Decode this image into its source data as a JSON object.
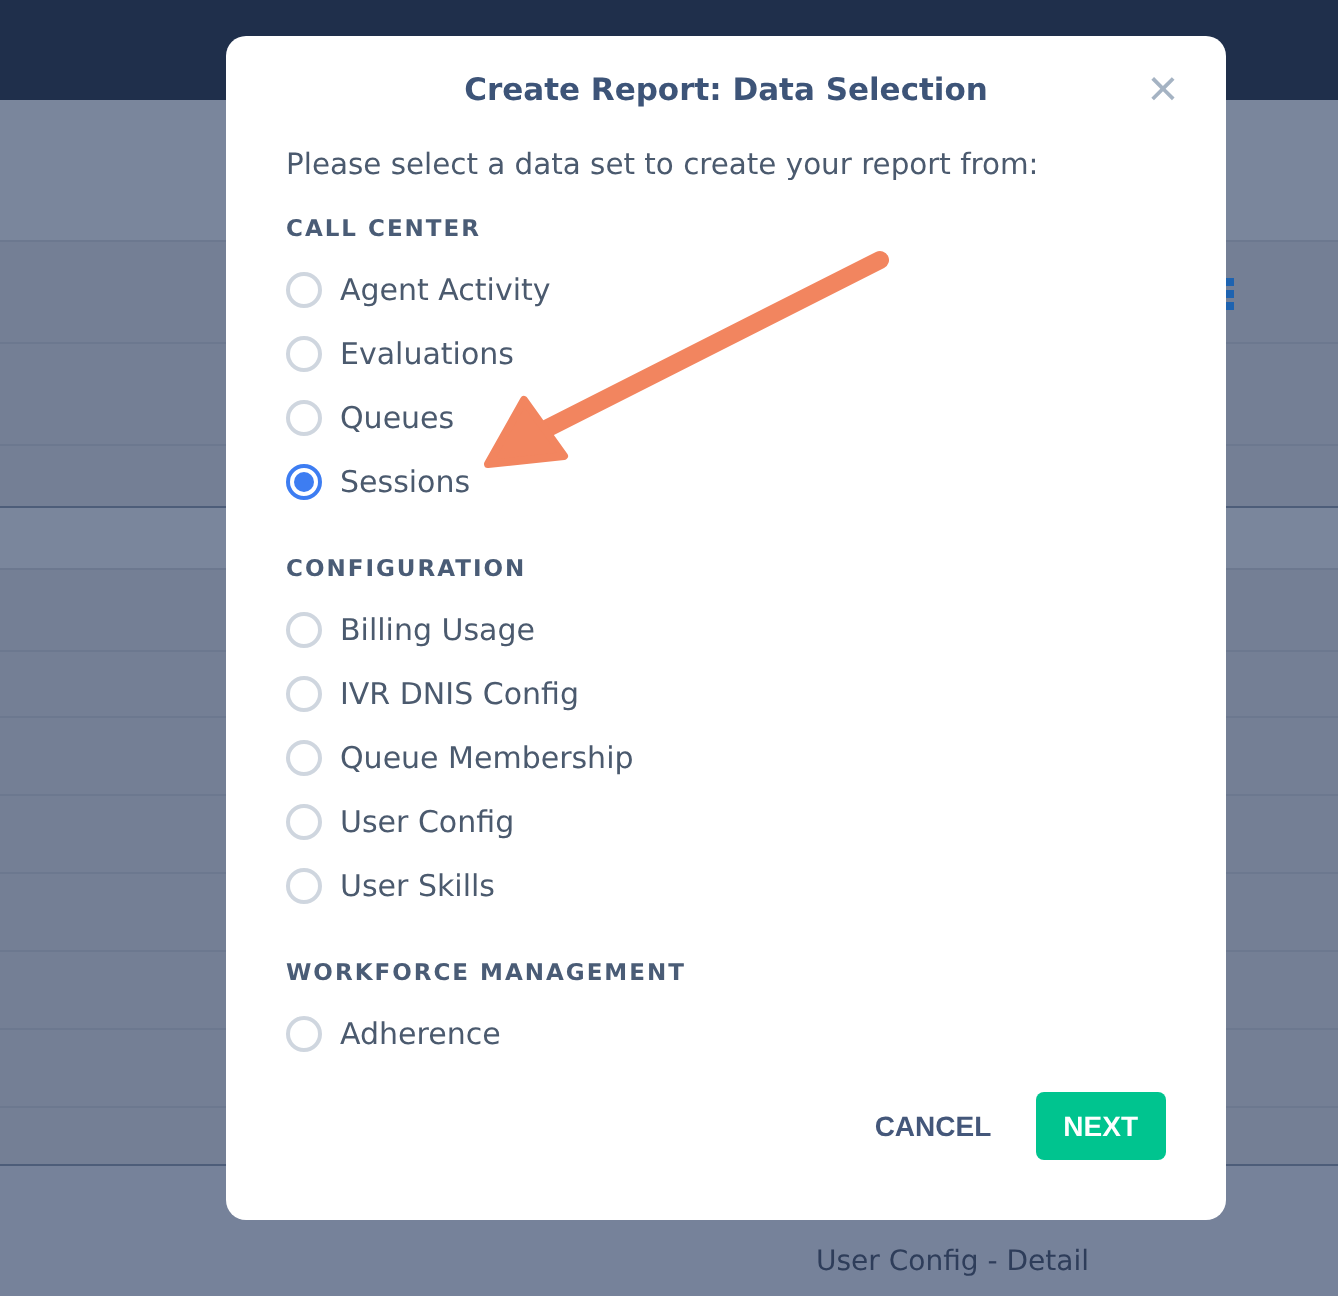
{
  "background": {
    "row_text": "User Config - Detail"
  },
  "dialog": {
    "title": "Create Report: Data Selection",
    "close": "×",
    "intro": "Please select a data set to create your report from:",
    "groups": [
      {
        "heading": "CALL CENTER",
        "options": [
          {
            "label": "Agent Activity",
            "selected": false
          },
          {
            "label": "Evaluations",
            "selected": false
          },
          {
            "label": "Queues",
            "selected": false
          },
          {
            "label": "Sessions",
            "selected": true
          }
        ]
      },
      {
        "heading": "CONFIGURATION",
        "options": [
          {
            "label": "Billing Usage",
            "selected": false
          },
          {
            "label": "IVR DNIS Config",
            "selected": false
          },
          {
            "label": "Queue Membership",
            "selected": false
          },
          {
            "label": "User Config",
            "selected": false
          },
          {
            "label": "User Skills",
            "selected": false
          }
        ]
      },
      {
        "heading": "WORKFORCE MANAGEMENT",
        "options": [
          {
            "label": "Adherence",
            "selected": false
          }
        ]
      }
    ],
    "buttons": [
      {
        "label": "CANCEL",
        "kind": "text"
      },
      {
        "label": "NEXT",
        "kind": "primary"
      }
    ]
  }
}
